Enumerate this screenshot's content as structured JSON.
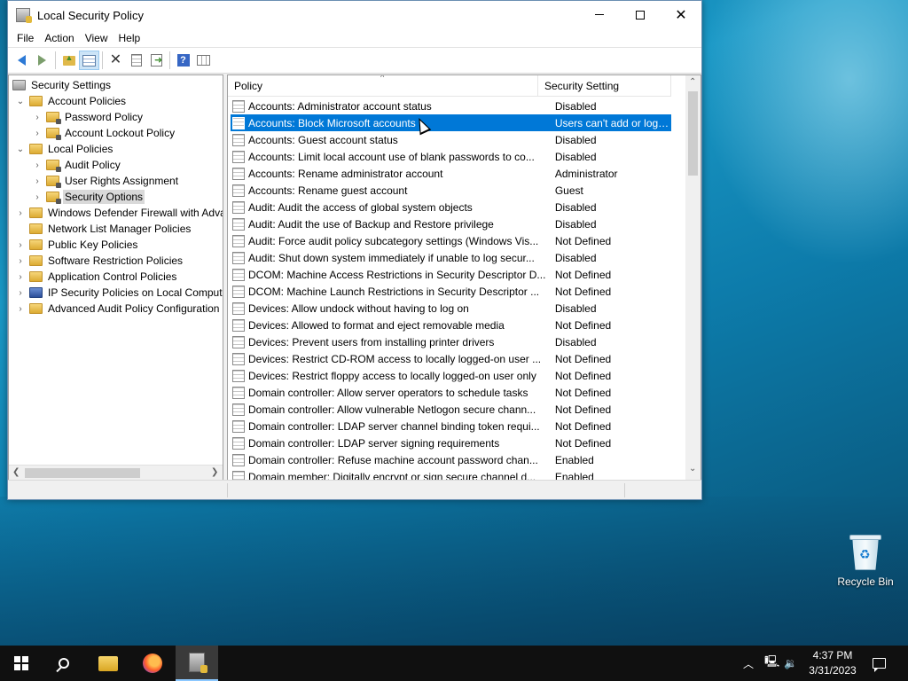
{
  "window": {
    "title": "Local Security Policy",
    "icon": "security-policy-icon"
  },
  "menu": [
    "File",
    "Action",
    "View",
    "Help"
  ],
  "toolbar": {
    "icons": [
      "back-arrow-icon",
      "forward-arrow-icon",
      "up-folder-icon",
      "show-hide-console-tree-icon",
      "delete-icon",
      "properties-icon",
      "export-list-icon",
      "help-icon",
      "show-hide-action-pane-icon"
    ]
  },
  "tree": {
    "items": [
      {
        "label": "Security Settings",
        "expander": "",
        "icon": "root"
      },
      {
        "label": "Account Policies",
        "expander": "⌄",
        "icon": "folder"
      },
      {
        "label": "Password Policy",
        "expander": "›",
        "icon": "lock"
      },
      {
        "label": "Account Lockout Policy",
        "expander": "›",
        "icon": "lock"
      },
      {
        "label": "Local Policies",
        "expander": "⌄",
        "icon": "folder"
      },
      {
        "label": "Audit Policy",
        "expander": "›",
        "icon": "lock"
      },
      {
        "label": "User Rights Assignment",
        "expander": "›",
        "icon": "lock"
      },
      {
        "label": "Security Options",
        "expander": "›",
        "icon": "lock",
        "selected": true
      },
      {
        "label": "Windows Defender Firewall with Adva",
        "expander": "›",
        "icon": "folder"
      },
      {
        "label": "Network List Manager Policies",
        "expander": "",
        "icon": "folder"
      },
      {
        "label": "Public Key Policies",
        "expander": "›",
        "icon": "folder"
      },
      {
        "label": "Software Restriction Policies",
        "expander": "›",
        "icon": "folder"
      },
      {
        "label": "Application Control Policies",
        "expander": "›",
        "icon": "folder"
      },
      {
        "label": "IP Security Policies on Local Compute",
        "expander": "›",
        "icon": "ipsec"
      },
      {
        "label": "Advanced Audit Policy Configuration",
        "expander": "›",
        "icon": "folder"
      }
    ]
  },
  "list": {
    "columns": [
      "Policy",
      "Security Setting"
    ],
    "rows": [
      {
        "policy": "Accounts: Administrator account status",
        "setting": "Disabled"
      },
      {
        "policy": "Accounts: Block Microsoft accounts",
        "setting": "Users can't add or log o...",
        "selected": true
      },
      {
        "policy": "Accounts: Guest account status",
        "setting": "Disabled"
      },
      {
        "policy": "Accounts: Limit local account use of blank passwords to co...",
        "setting": "Disabled"
      },
      {
        "policy": "Accounts: Rename administrator account",
        "setting": "Administrator"
      },
      {
        "policy": "Accounts: Rename guest account",
        "setting": "Guest"
      },
      {
        "policy": "Audit: Audit the access of global system objects",
        "setting": "Disabled"
      },
      {
        "policy": "Audit: Audit the use of Backup and Restore privilege",
        "setting": "Disabled"
      },
      {
        "policy": "Audit: Force audit policy subcategory settings (Windows Vis...",
        "setting": "Not Defined"
      },
      {
        "policy": "Audit: Shut down system immediately if unable to log secur...",
        "setting": "Disabled"
      },
      {
        "policy": "DCOM: Machine Access Restrictions in Security Descriptor D...",
        "setting": "Not Defined"
      },
      {
        "policy": "DCOM: Machine Launch Restrictions in Security Descriptor ...",
        "setting": "Not Defined"
      },
      {
        "policy": "Devices: Allow undock without having to log on",
        "setting": "Disabled"
      },
      {
        "policy": "Devices: Allowed to format and eject removable media",
        "setting": "Not Defined"
      },
      {
        "policy": "Devices: Prevent users from installing printer drivers",
        "setting": "Disabled"
      },
      {
        "policy": "Devices: Restrict CD-ROM access to locally logged-on user ...",
        "setting": "Not Defined"
      },
      {
        "policy": "Devices: Restrict floppy access to locally logged-on user only",
        "setting": "Not Defined"
      },
      {
        "policy": "Domain controller: Allow server operators to schedule tasks",
        "setting": "Not Defined"
      },
      {
        "policy": "Domain controller: Allow vulnerable Netlogon secure chann...",
        "setting": "Not Defined"
      },
      {
        "policy": "Domain controller: LDAP server channel binding token requi...",
        "setting": "Not Defined"
      },
      {
        "policy": "Domain controller: LDAP server signing requirements",
        "setting": "Not Defined"
      },
      {
        "policy": "Domain controller: Refuse machine account password chan...",
        "setting": "Enabled"
      },
      {
        "policy": "Domain member: Digitally encrypt or sign secure channel d...",
        "setting": "Enabled"
      }
    ]
  },
  "desktop": {
    "recycle_bin": "Recycle Bin"
  },
  "taskbar": {
    "apps": [
      "start-icon",
      "search-icon",
      "file-explorer-icon",
      "firefox-icon",
      "local-security-policy-icon"
    ],
    "tray": [
      "chevron-up-icon",
      "network-icon",
      "volume-icon"
    ],
    "time": "4:37 PM",
    "date": "3/31/2023"
  },
  "colors": {
    "selection": "#0078d7",
    "taskbar": "#101010"
  }
}
